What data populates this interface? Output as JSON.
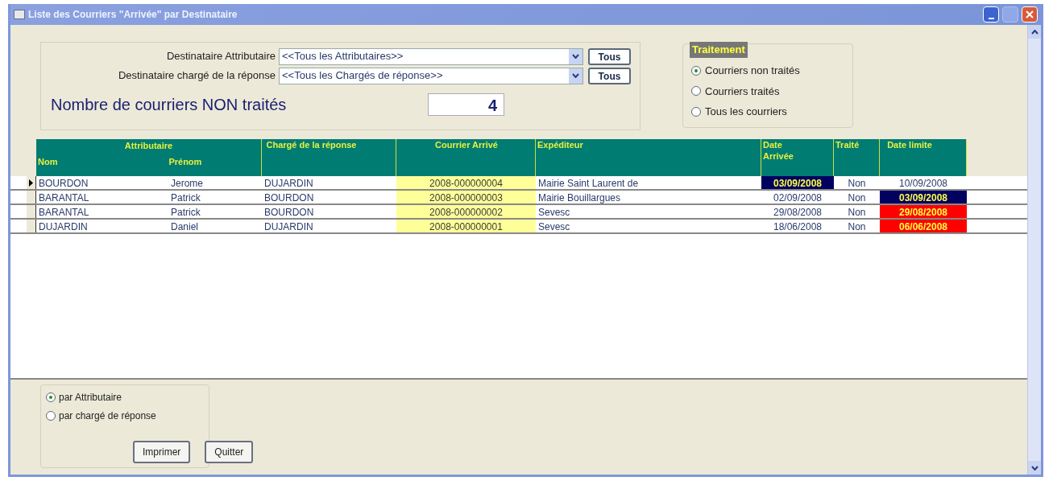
{
  "window": {
    "title": "Liste des Courriers \"Arrivée\" par Destinataire"
  },
  "filters": [
    {
      "label": "Destinataire Attributaire",
      "value": "<<Tous les Attributaires>>",
      "button": "Tous"
    },
    {
      "label": "Destinataire chargé de la réponse",
      "value": "<<Tous les Chargés de réponse>>",
      "button": "Tous"
    }
  ],
  "count": {
    "label": "Nombre de courriers NON traités",
    "value": "4"
  },
  "traitement": {
    "title": "Traitement",
    "options": [
      {
        "label": "Courriers non traités",
        "selected": true
      },
      {
        "label": "Courriers traités",
        "selected": false
      },
      {
        "label": "Tous les courriers",
        "selected": false
      }
    ]
  },
  "table": {
    "group_heading": "Attributaire",
    "columns": [
      "Nom",
      "Prénom",
      "Chargé de la réponse",
      "Courrier Arrivé",
      "Expéditeur",
      "Date Arrivée",
      "Traité",
      "Date limite"
    ],
    "rows": [
      {
        "current": true,
        "cells": [
          "BOURDON",
          "Jerome",
          "DUJARDIN",
          "2008-000000004",
          "Mairie Saint Laurent de",
          "03/09/2008",
          "Non",
          "10/09/2008"
        ],
        "arrival_due": true,
        "limit_due": false,
        "limit_overdue": false
      },
      {
        "current": false,
        "cells": [
          "BARANTAL",
          "Patrick",
          "BOURDON",
          "2008-000000003",
          "Mairie Bouillargues",
          "02/09/2008",
          "Non",
          "03/09/2008"
        ],
        "arrival_due": false,
        "limit_due": true,
        "limit_overdue": false
      },
      {
        "current": false,
        "cells": [
          "BARANTAL",
          "Patrick",
          "BOURDON",
          "2008-000000002",
          "Sevesc",
          "29/08/2008",
          "Non",
          "29/08/2008"
        ],
        "arrival_due": false,
        "limit_due": false,
        "limit_overdue": true
      },
      {
        "current": false,
        "cells": [
          "DUJARDIN",
          "Daniel",
          "DUJARDIN",
          "2008-000000001",
          "Sevesc",
          "18/06/2008",
          "Non",
          "06/06/2008"
        ],
        "arrival_due": false,
        "limit_due": false,
        "limit_overdue": true
      }
    ]
  },
  "sort": {
    "options": [
      {
        "label": "par Attributaire",
        "selected": true
      },
      {
        "label": "par chargé de réponse",
        "selected": false
      }
    ]
  },
  "buttons": [
    "Imprimer",
    "Quitter"
  ]
}
